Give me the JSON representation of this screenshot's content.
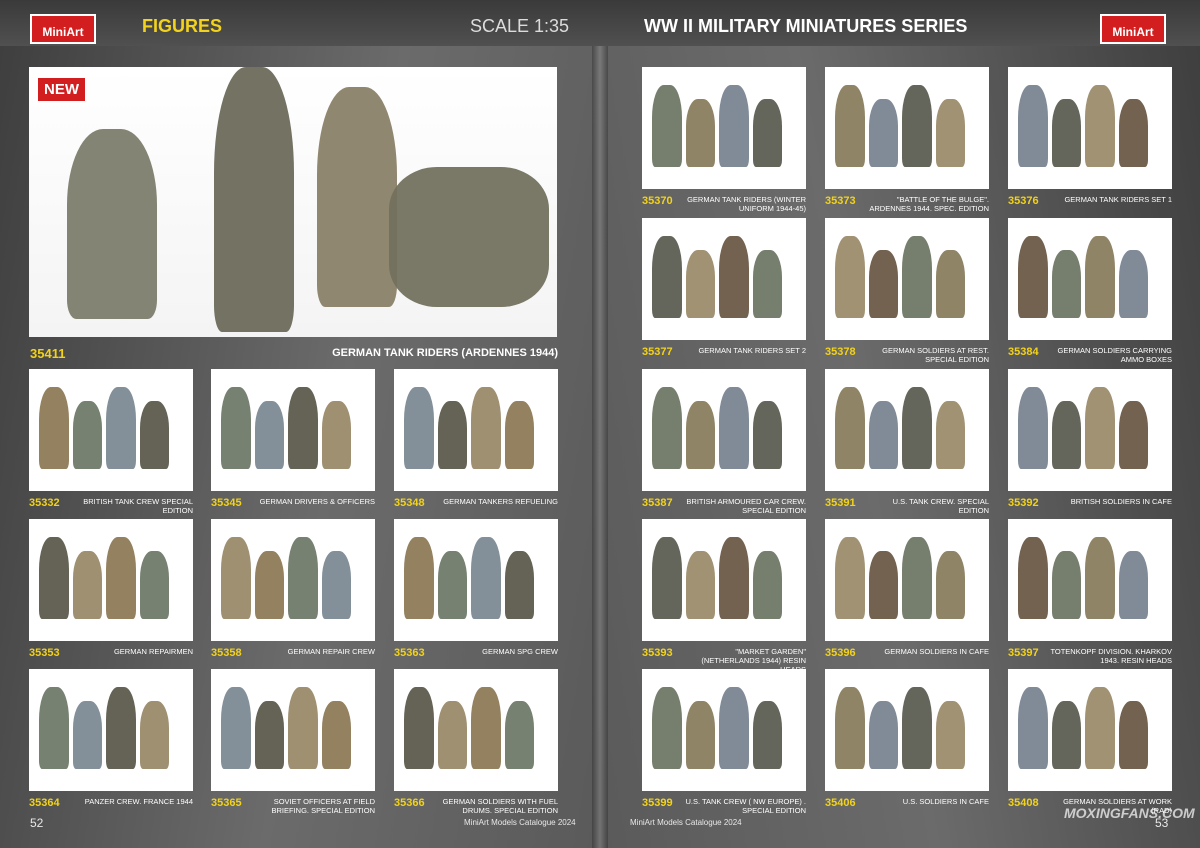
{
  "header": {
    "left_logo": "MiniArt",
    "right_logo": "MiniArt",
    "section": "FIGURES",
    "scale": "SCALE 1:35",
    "series": "WW II MILITARY MINIATURES SERIES"
  },
  "hero": {
    "badge": "NEW",
    "code": "35411",
    "name": "GERMAN TANK RIDERS (ARDENNES 1944)"
  },
  "left_items": [
    {
      "code": "35332",
      "name": "BRITISH TANK CREW SPECIAL EDITION"
    },
    {
      "code": "35345",
      "name": "GERMAN DRIVERS & OFFICERS"
    },
    {
      "code": "35348",
      "name": "GERMAN TANKERS REFUELING"
    },
    {
      "code": "35353",
      "name": "GERMAN REPAIRMEN"
    },
    {
      "code": "35358",
      "name": "GERMAN REPAIR CREW"
    },
    {
      "code": "35363",
      "name": "GERMAN SPG CREW"
    },
    {
      "code": "35364",
      "name": "PANZER CREW. FRANCE 1944"
    },
    {
      "code": "35365",
      "name": "SOVIET OFFICERS AT FIELD BRIEFING. SPECIAL EDITION"
    },
    {
      "code": "35366",
      "name": "GERMAN SOLDIERS WITH FUEL DRUMS. SPECIAL EDITION"
    }
  ],
  "right_items": [
    {
      "code": "35370",
      "name": "GERMAN TANK RIDERS (WINTER UNIFORM 1944-45)"
    },
    {
      "code": "35373",
      "name": "\"BATTLE OF THE BULGE\". ARDENNES 1944. SPEC. EDITION"
    },
    {
      "code": "35376",
      "name": "GERMAN TANK RIDERS SET 1"
    },
    {
      "code": "35377",
      "name": "GERMAN TANK RIDERS SET 2"
    },
    {
      "code": "35378",
      "name": "GERMAN SOLDIERS AT REST. SPECIAL EDITION"
    },
    {
      "code": "35384",
      "name": "GERMAN SOLDIERS CARRYING AMMO BOXES"
    },
    {
      "code": "35387",
      "name": "BRITISH ARMOURED CAR CREW. SPECIAL EDITION"
    },
    {
      "code": "35391",
      "name": "U.S. TANK CREW. SPECIAL EDITION"
    },
    {
      "code": "35392",
      "name": "BRITISH SOLDIERS IN CAFE"
    },
    {
      "code": "35393",
      "name": "\"MARKET GARDEN\" (NETHERLANDS 1944) RESIN HEADS"
    },
    {
      "code": "35396",
      "name": "GERMAN SOLDIERS IN CAFE"
    },
    {
      "code": "35397",
      "name": "TOTENKOPF DIVISION. KHARKOV 1943. RESIN HEADS"
    },
    {
      "code": "35399",
      "name": "U.S. TANK CREW ( NW EUROPE) . SPECIAL EDITION"
    },
    {
      "code": "35406",
      "name": "U.S. SOLDIERS IN CAFE"
    },
    {
      "code": "35408",
      "name": "GERMAN SOLDIERS AT WORK (RAD)"
    }
  ],
  "footer": {
    "left_page": "52",
    "right_page": "53",
    "left_catalogue": "MiniArt Models Catalogue 2024",
    "right_catalogue": "MiniArt Models Catalogue 2024",
    "watermark": "MOXINGFANS.COM"
  },
  "colors": {
    "accent_yellow": "#f2d21b",
    "brand_red": "#d21e1e"
  }
}
